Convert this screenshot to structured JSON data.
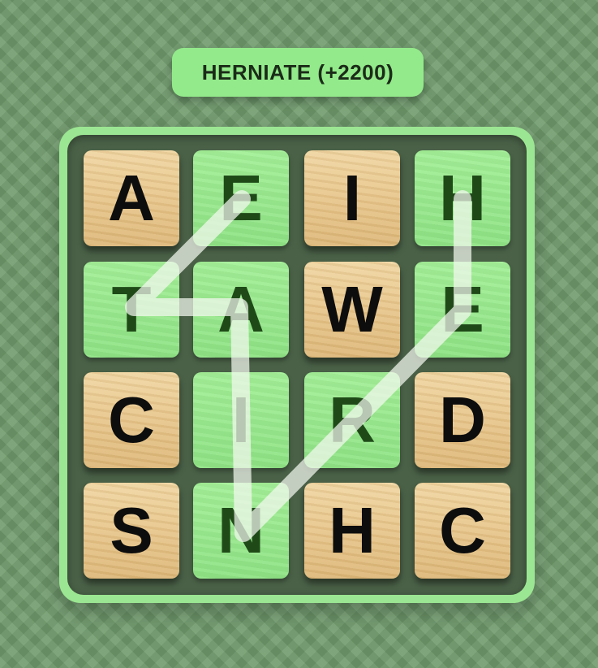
{
  "found_word": {
    "text": "HERNIATE (+2200)"
  },
  "board": {
    "rows": [
      [
        {
          "letter": "A",
          "selected": false
        },
        {
          "letter": "E",
          "selected": true
        },
        {
          "letter": "I",
          "selected": false
        },
        {
          "letter": "H",
          "selected": true
        }
      ],
      [
        {
          "letter": "T",
          "selected": true
        },
        {
          "letter": "A",
          "selected": true
        },
        {
          "letter": "W",
          "selected": false
        },
        {
          "letter": "E",
          "selected": true
        }
      ],
      [
        {
          "letter": "C",
          "selected": false
        },
        {
          "letter": "I",
          "selected": true
        },
        {
          "letter": "R",
          "selected": true
        },
        {
          "letter": "D",
          "selected": false
        }
      ],
      [
        {
          "letter": "S",
          "selected": false
        },
        {
          "letter": "N",
          "selected": true
        },
        {
          "letter": "H",
          "selected": false
        },
        {
          "letter": "C",
          "selected": false
        }
      ]
    ]
  },
  "colors": {
    "background": "#6f9a6c",
    "board_rim": "#9be692",
    "board_well": "#4a6147",
    "selected_tile": "#97e78c",
    "wood_tile": "#e7c58a",
    "path": "#f4f8f0"
  }
}
